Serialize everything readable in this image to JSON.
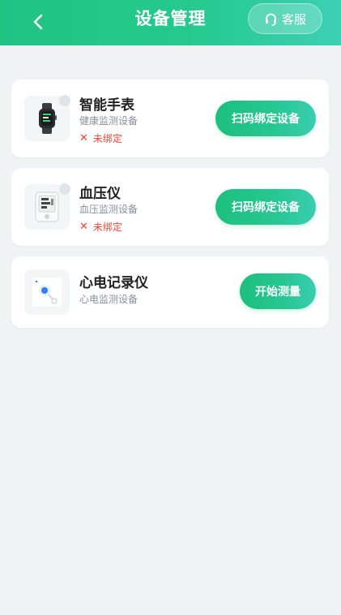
{
  "header": {
    "title": "设备管理",
    "service_label": "客服"
  },
  "devices": [
    {
      "name": "智能手表",
      "type": "健康监测设备",
      "status": "未绑定",
      "action_label": "扫码绑定设备"
    },
    {
      "name": "血压仪",
      "type": "血压监测设备",
      "status": "未绑定",
      "action_label": "扫码绑定设备"
    },
    {
      "name": "心电记录仪",
      "type": "心电监测设备",
      "action_label": "开始测量"
    }
  ],
  "icons": {
    "back": "chevron-left-icon",
    "service": "headset-icon",
    "unbound": "x-icon"
  },
  "colors": {
    "primary": "#22c48a",
    "danger": "#f0463b",
    "background": "#f1f2f4"
  }
}
